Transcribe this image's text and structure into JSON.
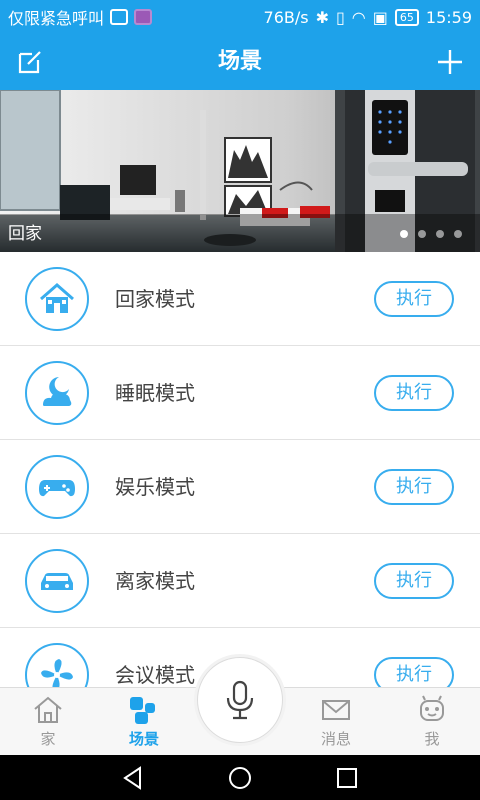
{
  "status_bar": {
    "carrier_text": "仅限紧急呼叫",
    "network_speed": "76B/s",
    "battery_level": "65",
    "time": "15:59"
  },
  "header": {
    "title": "场景",
    "edit_icon": "edit-icon",
    "add_icon": "plus-icon"
  },
  "banner": {
    "caption": "回家",
    "page_count": 4,
    "active_page": 1
  },
  "scenes": [
    {
      "label": "回家模式",
      "icon": "house-icon",
      "action": "执行"
    },
    {
      "label": "睡眠模式",
      "icon": "moon-cloud-icon",
      "action": "执行"
    },
    {
      "label": "娱乐模式",
      "icon": "gamepad-icon",
      "action": "执行"
    },
    {
      "label": "离家模式",
      "icon": "car-icon",
      "action": "执行"
    },
    {
      "label": "会议模式",
      "icon": "fan-icon",
      "action": "执行"
    }
  ],
  "bottom_nav": {
    "items": [
      {
        "label": "家",
        "icon": "house-outline-icon",
        "active": false
      },
      {
        "label": "场景",
        "icon": "scene-blocks-icon",
        "active": true
      },
      {
        "label": "消息",
        "icon": "envelope-icon",
        "active": false
      },
      {
        "label": "我",
        "icon": "robot-icon",
        "active": false
      }
    ],
    "mic_icon": "microphone-icon"
  },
  "colors": {
    "accent": "#1ea2ea",
    "icon_blue": "#38adee",
    "text": "#444444"
  }
}
